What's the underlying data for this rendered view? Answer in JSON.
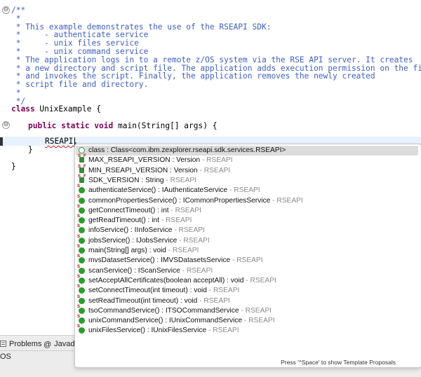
{
  "editor": {
    "code_lines": [
      {
        "kind": "comment",
        "text": "/**"
      },
      {
        "kind": "comment",
        "text": " *"
      },
      {
        "kind": "comment",
        "text": " * This example demonstrates the use of the RSEAPI SDK:"
      },
      {
        "kind": "comment",
        "text": " *     - authenticate service"
      },
      {
        "kind": "comment",
        "text": " *     - unix files service"
      },
      {
        "kind": "comment",
        "text": " *     - unix command service"
      },
      {
        "kind": "comment",
        "text": " * The application logs in to a remote z/OS system via the RSE API server. It creates"
      },
      {
        "kind": "comment",
        "text": " * a new directory and script file. The application adds execution permission on the file,"
      },
      {
        "kind": "comment",
        "text": " * and invokes the script. Finally, the application removes the newly created"
      },
      {
        "kind": "comment",
        "text": " * script file and directory."
      },
      {
        "kind": "comment",
        "text": " *"
      },
      {
        "kind": "comment",
        "text": " */"
      }
    ],
    "class_keyword": "class",
    "class_name": " UnixExample {",
    "method_keywords": "public static void",
    "method_signature": " main(String[] args) {",
    "typed_text": "RSEAPI.",
    "close_brace_inner": "}",
    "close_brace_outer": "}",
    "fold_symbol_1": "⊖",
    "fold_symbol_2": "⊖"
  },
  "completion_popup": {
    "items": [
      {
        "icon": "class-icon",
        "label": "class : Class<com.ibm.zexplorer.rseapi.sdk.services.RSEAPI>",
        "origin": "",
        "selected": true
      },
      {
        "icon": "static-final-field-icon",
        "label": "MAX_RSEAPI_VERSION : Version",
        "origin": " - RSEAPI",
        "selected": false
      },
      {
        "icon": "static-final-field-icon",
        "label": "MIN_RSEAPI_VERSION : Version",
        "origin": " - RSEAPI",
        "selected": false
      },
      {
        "icon": "static-final-field-icon",
        "label": "SDK_VERSION : String",
        "origin": " - RSEAPI",
        "selected": false
      },
      {
        "icon": "static-method-icon",
        "label": "authenticateService() : IAuthenticateService",
        "origin": " - RSEAPI",
        "selected": false
      },
      {
        "icon": "static-method-icon",
        "label": "commonPropertiesService() : ICommonPropertiesService",
        "origin": " - RSEAPI",
        "selected": false
      },
      {
        "icon": "static-method-icon",
        "label": "getConnectTimeout() : int",
        "origin": " - RSEAPI",
        "selected": false
      },
      {
        "icon": "static-method-icon",
        "label": "getReadTimeout() : int",
        "origin": " - RSEAPI",
        "selected": false
      },
      {
        "icon": "static-method-icon",
        "label": "infoService() : IInfoService",
        "origin": " - RSEAPI",
        "selected": false
      },
      {
        "icon": "static-method-icon",
        "label": "jobsService() : IJobsService",
        "origin": " - RSEAPI",
        "selected": false
      },
      {
        "icon": "static-method-icon",
        "label": "main(String[] args) : void",
        "origin": " - RSEAPI",
        "selected": false
      },
      {
        "icon": "static-method-icon",
        "label": "mvsDatasetService() : IMVSDatasetsService",
        "origin": " - RSEAPI",
        "selected": false
      },
      {
        "icon": "static-method-icon",
        "label": "scanService() : IScanService",
        "origin": " - RSEAPI",
        "selected": false
      },
      {
        "icon": "static-method-icon",
        "label": "setAcceptAllCertificates(boolean acceptAll) : void",
        "origin": " - RSEAPI",
        "selected": false
      },
      {
        "icon": "static-method-icon",
        "label": "setConnectTimeout(int timeout) : void",
        "origin": " - RSEAPI",
        "selected": false
      },
      {
        "icon": "static-method-icon",
        "label": "setReadTimeout(int timeout) : void",
        "origin": " - RSEAPI",
        "selected": false
      },
      {
        "icon": "static-method-icon",
        "label": "tsoCommandService() : ITSOCommandService",
        "origin": " - RSEAPI",
        "selected": false
      },
      {
        "icon": "static-method-icon",
        "label": "unixCommandService() : IUnixCommandService",
        "origin": " - RSEAPI",
        "selected": false
      },
      {
        "icon": "static-method-icon",
        "label": "unixFilesService() : IUnixFilesService",
        "origin": " - RSEAPI",
        "selected": false
      }
    ],
    "footer_hint": "Press '^Space' to show Template Proposals"
  },
  "bottom_panel": {
    "tabs": [
      {
        "label": "Problems",
        "icon": "problems-icon"
      },
      {
        "label": "Javado",
        "icon": "at-icon"
      }
    ],
    "status_text": "OS"
  }
}
